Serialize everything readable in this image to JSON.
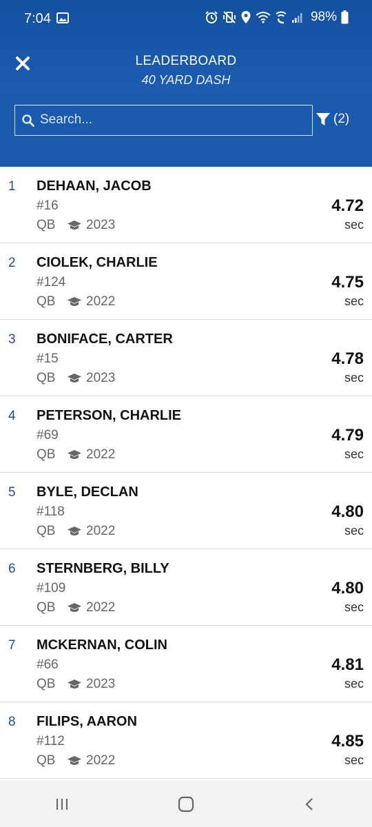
{
  "status_bar": {
    "time": "7:04",
    "battery": "98%",
    "icons": [
      "image-icon",
      "alarm-icon",
      "vibrate-mute-icon",
      "location-icon",
      "wifi-icon",
      "wifi-calling-icon",
      "signal-icon",
      "battery-icon"
    ]
  },
  "header": {
    "title": "LEADERBOARD",
    "subtitle": "40 YARD DASH",
    "close_icon": "close-icon",
    "search_placeholder": "Search...",
    "filter_count": "(2)"
  },
  "colors": {
    "header_bg": "#1a56a8",
    "rank_color": "#1b4f96"
  },
  "leaderboard": [
    {
      "rank": "1",
      "name": "DEHAAN, JACOB",
      "jersey": "#16",
      "position": "QB",
      "grad_year": "2023",
      "time": "4.72",
      "unit": "sec"
    },
    {
      "rank": "2",
      "name": "CIOLEK, CHARLIE",
      "jersey": "#124",
      "position": "QB",
      "grad_year": "2022",
      "time": "4.75",
      "unit": "sec"
    },
    {
      "rank": "3",
      "name": "BONIFACE, CARTER",
      "jersey": "#15",
      "position": "QB",
      "grad_year": "2023",
      "time": "4.78",
      "unit": "sec"
    },
    {
      "rank": "4",
      "name": "PETERSON, CHARLIE",
      "jersey": "#69",
      "position": "QB",
      "grad_year": "2022",
      "time": "4.79",
      "unit": "sec"
    },
    {
      "rank": "5",
      "name": "BYLE, DECLAN",
      "jersey": "#118",
      "position": "QB",
      "grad_year": "2022",
      "time": "4.80",
      "unit": "sec"
    },
    {
      "rank": "6",
      "name": "STERNBERG, BILLY",
      "jersey": "#109",
      "position": "QB",
      "grad_year": "2022",
      "time": "4.80",
      "unit": "sec"
    },
    {
      "rank": "7",
      "name": "MCKERNAN, COLIN",
      "jersey": "#66",
      "position": "QB",
      "grad_year": "2023",
      "time": "4.81",
      "unit": "sec"
    },
    {
      "rank": "8",
      "name": "FILIPS, AARON",
      "jersey": "#112",
      "position": "QB",
      "grad_year": "2022",
      "time": "4.85",
      "unit": "sec"
    }
  ],
  "nav_bar": {
    "buttons": [
      "recent-apps-icon",
      "home-icon",
      "back-icon"
    ]
  }
}
